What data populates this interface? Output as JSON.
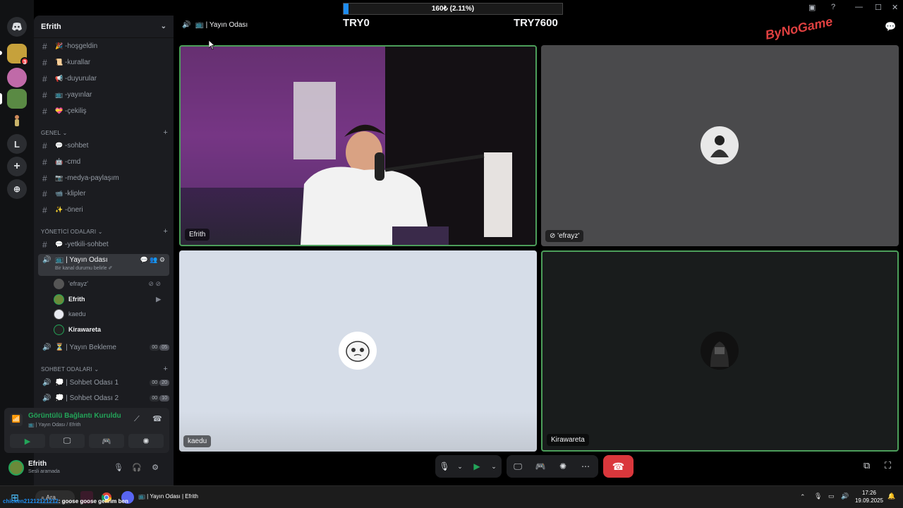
{
  "server": {
    "name": "Efrith"
  },
  "rail": {
    "dm_badge": "3",
    "letter_server": "L"
  },
  "channels_top": [
    {
      "emoji": "🎉",
      "label": "-hoşgeldin"
    },
    {
      "emoji": "📜",
      "label": "-kurallar"
    },
    {
      "emoji": "📢",
      "label": "-duyurular"
    },
    {
      "emoji": "📺",
      "label": "-yayınlar"
    },
    {
      "emoji": "💝",
      "label": "-çekiliş"
    }
  ],
  "categories": {
    "genel": "GENEL",
    "yonetici": "YÖNETİCİ ODALARI",
    "sohbet": "SOHBET ODALARI"
  },
  "channels_genel": [
    {
      "emoji": "💬",
      "label": "-sohbet"
    },
    {
      "emoji": "🤖",
      "label": "-cmd"
    },
    {
      "emoji": "📷",
      "label": "-medya-paylaşım"
    },
    {
      "emoji": "📹",
      "label": "-klipler"
    },
    {
      "emoji": "✨",
      "label": "-öneri"
    }
  ],
  "channels_yonetici": [
    {
      "emoji": "💬",
      "label": "-yetkili-sohbet"
    }
  ],
  "active_voice": {
    "label": "📺 | Yayın Odası",
    "status_hint": "Bir kanal durumu belirle ✐"
  },
  "voice_users": [
    {
      "name": "'efrayz'",
      "bold": false,
      "right": "⊘ ⊘"
    },
    {
      "name": "Efrith",
      "bold": true,
      "right": "▶"
    },
    {
      "name": "kaedu",
      "bold": false,
      "right": ""
    },
    {
      "name": "Kirawareta",
      "bold": true,
      "right": ""
    }
  ],
  "voice_waiting": {
    "label": "⏳ | Yayın Bekleme",
    "count_a": "00",
    "count_b": "05"
  },
  "sohbet_rooms": [
    {
      "label": "💭 | Sohbet Odası 1",
      "count_a": "00",
      "count_b": "20"
    },
    {
      "label": "💭 | Sohbet Odası 2",
      "count_a": "00",
      "count_b": "10"
    }
  ],
  "voice_panel": {
    "status": "Görüntülü Bağlantı Kuruldu",
    "sub": "📺 | Yayın Odası / Efrith"
  },
  "user_panel": {
    "name": "Efrith",
    "status": "Sesli aramada"
  },
  "topbar": {
    "title": "📺 | Yayın Odası"
  },
  "donation": {
    "progress_text": "160₺ (2.11%)",
    "progress_fraction": 0.0211,
    "left": "TRY0",
    "right": "TRY7600"
  },
  "overlay_logo": "ByNoGame",
  "tiles": {
    "t1": "Efrith",
    "t2": "'efrayz'",
    "t3": "kaedu",
    "t4": "Kirawareta"
  },
  "taskbar": {
    "search": "Ara",
    "window_title": "📺 | Yayın Odası | Efrith",
    "chat_name": "chicken21212121212",
    "chat_msg": ": goose goose gelirim ben",
    "time": "17:26",
    "date": "19.09.2025"
  },
  "colors": {
    "accent_green": "#23a559",
    "danger": "#da373c",
    "progress": "#1e8cf0",
    "speaking_border": "#4c9e5a"
  }
}
